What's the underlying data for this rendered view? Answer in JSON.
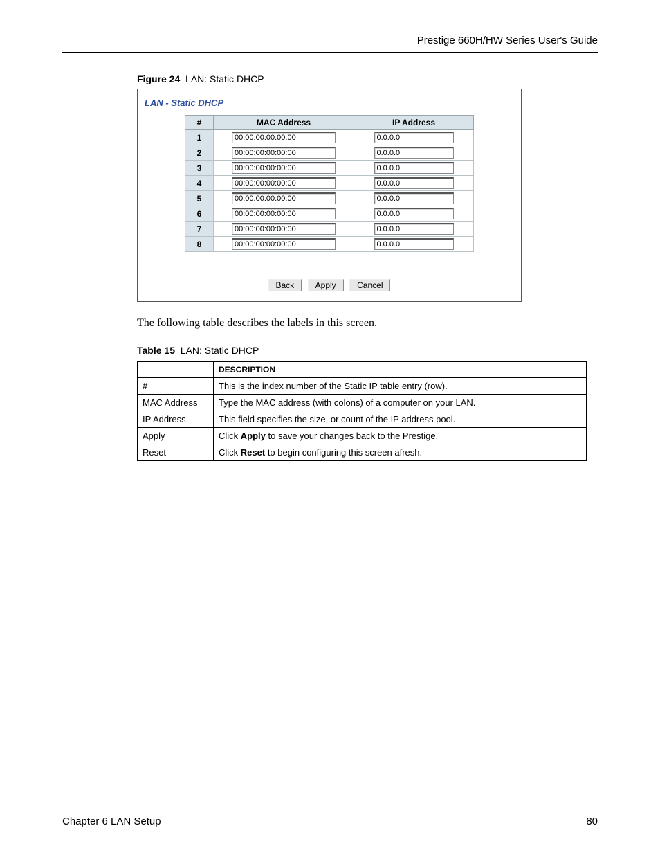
{
  "header": {
    "title": "Prestige 660H/HW Series User's Guide"
  },
  "figure": {
    "label": "Figure 24",
    "title": "LAN: Static DHCP",
    "panel_title": "LAN - Static DHCP",
    "columns": {
      "idx": "#",
      "mac": "MAC Address",
      "ip": "IP Address"
    },
    "rows": [
      {
        "idx": "1",
        "mac": "00:00:00:00:00:00",
        "ip": "0.0.0.0"
      },
      {
        "idx": "2",
        "mac": "00:00:00:00:00:00",
        "ip": "0.0.0.0"
      },
      {
        "idx": "3",
        "mac": "00:00:00:00:00:00",
        "ip": "0.0.0.0"
      },
      {
        "idx": "4",
        "mac": "00:00:00:00:00:00",
        "ip": "0.0.0.0"
      },
      {
        "idx": "5",
        "mac": "00:00:00:00:00:00",
        "ip": "0.0.0.0"
      },
      {
        "idx": "6",
        "mac": "00:00:00:00:00:00",
        "ip": "0.0.0.0"
      },
      {
        "idx": "7",
        "mac": "00:00:00:00:00:00",
        "ip": "0.0.0.0"
      },
      {
        "idx": "8",
        "mac": "00:00:00:00:00:00",
        "ip": "0.0.0.0"
      }
    ],
    "buttons": {
      "back": "Back",
      "apply": "Apply",
      "cancel": "Cancel"
    }
  },
  "body_text": "The following table describes the labels in this screen.",
  "table15": {
    "label": "Table 15",
    "title": "LAN: Static DHCP",
    "header": {
      "col1": "",
      "col2": "DESCRIPTION"
    },
    "rows": [
      {
        "label": "#",
        "desc_pre": "",
        "bold": "",
        "desc_post": "This is the index number of the Static IP table entry (row)."
      },
      {
        "label": "MAC Address",
        "desc_pre": "",
        "bold": "",
        "desc_post": "Type the MAC address (with colons) of a computer on your LAN."
      },
      {
        "label": "IP Address",
        "desc_pre": "",
        "bold": "",
        "desc_post": "This field specifies the size, or count of the IP address pool."
      },
      {
        "label": "Apply",
        "desc_pre": "Click ",
        "bold": "Apply",
        "desc_post": " to save your changes back to the Prestige."
      },
      {
        "label": "Reset",
        "desc_pre": "Click ",
        "bold": "Reset",
        "desc_post": " to begin configuring this screen afresh."
      }
    ]
  },
  "footer": {
    "chapter": "Chapter 6 LAN Setup",
    "page": "80"
  }
}
